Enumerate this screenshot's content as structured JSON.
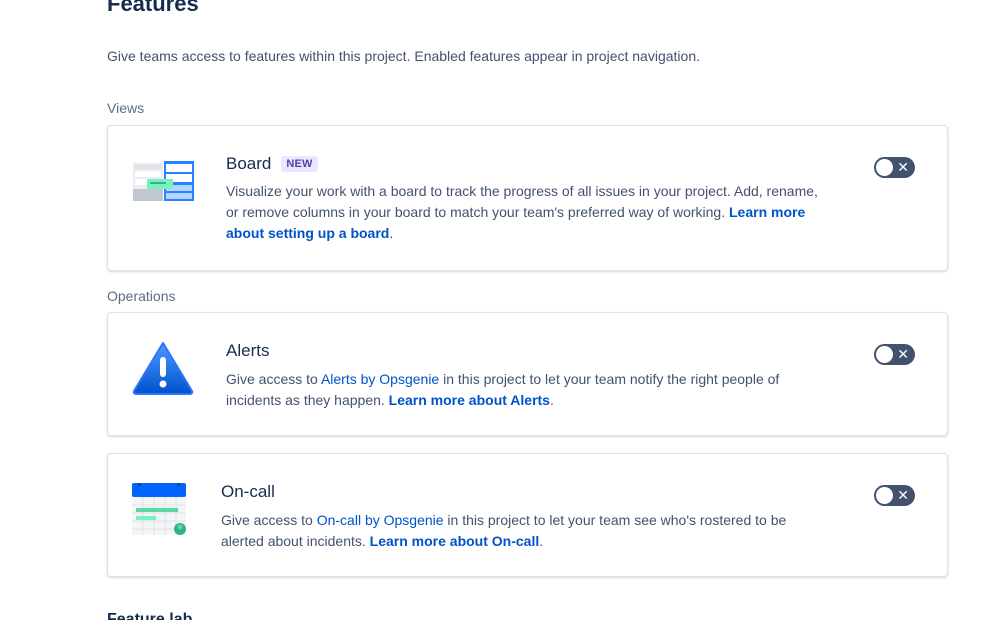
{
  "page": {
    "title": "Features",
    "description": "Give teams access to features within this project. Enabled features appear in project navigation."
  },
  "sections": {
    "views": "Views",
    "operations": "Operations",
    "feature_lab": "Feature lab"
  },
  "board": {
    "title": "Board",
    "badge": "NEW",
    "desc_main": "Visualize your work with a board to track the progress of all issues in your project. Add, rename, or remove columns in your board to match your team's preferred way of working. ",
    "link": "Learn more about setting up a board",
    "trail": ".",
    "enabled": false,
    "icon": "board-illustration"
  },
  "alerts": {
    "title": "Alerts",
    "desc_before": "Give access to ",
    "product_link": "Alerts by Opsgenie",
    "desc_after": " in this project to let your team notify the right people of incidents as they happen. ",
    "link": "Learn more about Alerts",
    "trail": ".",
    "enabled": false,
    "icon": "warning-triangle-icon"
  },
  "oncall": {
    "title": "On-call",
    "desc_before": "Give access to ",
    "product_link": "On-call by Opsgenie",
    "desc_after": " in this project to let your team see who's rostered to be alerted about incidents. ",
    "link": "Learn more about On-call",
    "trail": ".",
    "enabled": false,
    "icon": "calendar-illustration"
  },
  "toggle_off_glyph": "✕",
  "colors": {
    "link": "#0052cc",
    "toggle_off": "#42526e",
    "badge_bg": "#eae6ff",
    "badge_text": "#5243aa",
    "alert_blue": "#1f6bff"
  }
}
